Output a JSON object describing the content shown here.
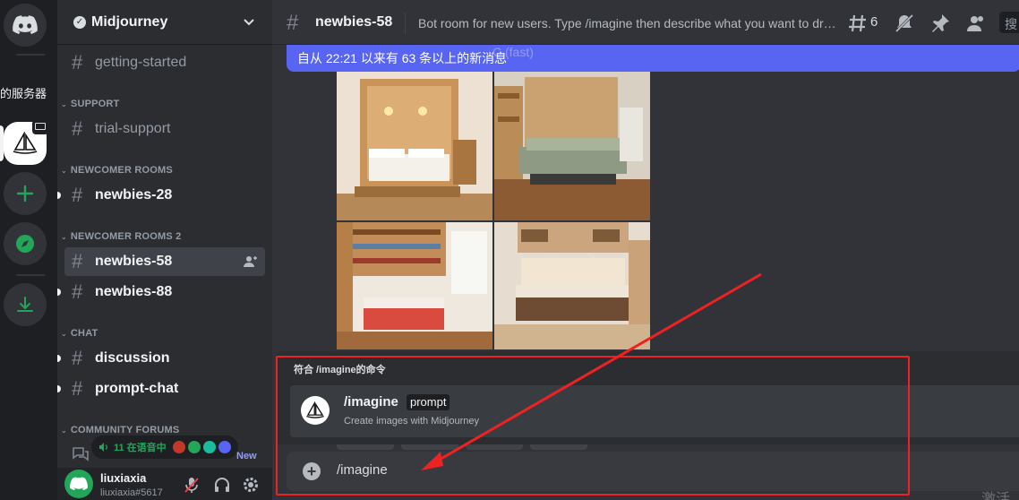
{
  "server_rail": {
    "partial_server_label": "的服务器"
  },
  "guild": {
    "name": "Midjourney"
  },
  "sidebar": {
    "channels_top": [
      {
        "name": "getting-started"
      }
    ],
    "categories": {
      "support": "SUPPORT",
      "newcomer_rooms": "NEWCOMER ROOMS",
      "newcomer_rooms_2": "NEWCOMER ROOMS 2",
      "chat": "CHAT",
      "community_forums": "COMMUNITY FORUMS"
    },
    "support_channels": [
      "trial-support"
    ],
    "newcomer_channels": [
      "newbies-28"
    ],
    "newcomer2_channels": [
      "newbies-58",
      "newbies-88"
    ],
    "chat_channels": [
      "discussion",
      "prompt-chat"
    ],
    "voice_status": "11 在语音中",
    "new_badge": "New"
  },
  "user": {
    "name": "liuxiaxia",
    "tag": "liuxiaxia#5617"
  },
  "channel": {
    "name": "newbies-58",
    "topic": "Bot room for new users. Type /imagine then describe what you want to draw...",
    "threads_count": "6",
    "search_placeholder": "搜"
  },
  "banner": {
    "text": "自从 22:21 以来有 63 条以上的新消息",
    "ghost_text": "C (fast)"
  },
  "autocomplete": {
    "title": "符合 /imagine的命令",
    "command": "/imagine",
    "option": "prompt",
    "description": "Create images with Midjourney"
  },
  "composer": {
    "value": "/imagine"
  },
  "watermark": "激活",
  "colors": {
    "blurple": "#5865f2",
    "annotation_red": "#ee2222",
    "online_green": "#23a55a"
  }
}
